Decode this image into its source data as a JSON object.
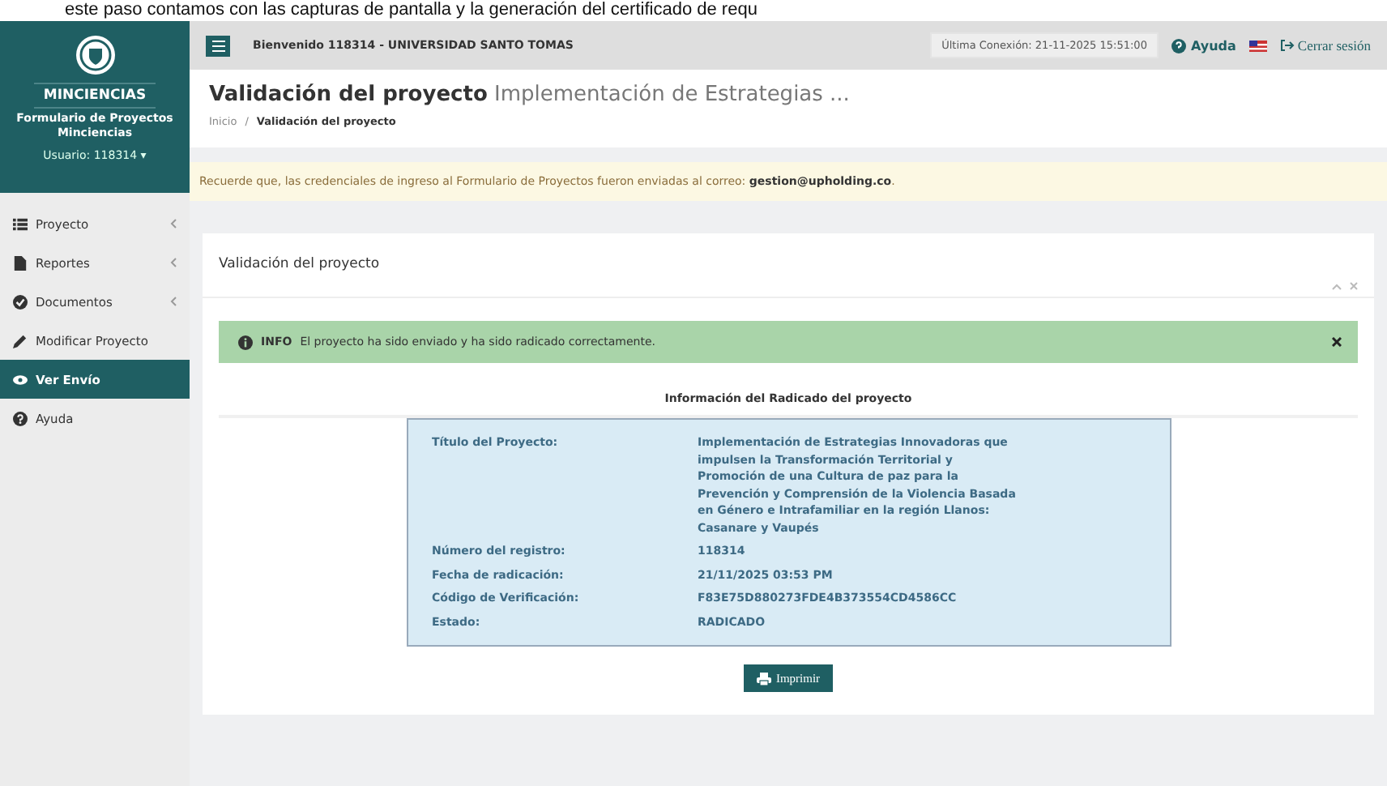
{
  "caption": "este paso contamos con las capturas de pantalla y la generación del certificado de requ",
  "sidebar": {
    "brand": "MINCIENCIAS",
    "subtitle": "Formulario de Proyectos Minciencias",
    "user": "Usuario: 118314 ▾",
    "items": [
      {
        "label": "Proyecto",
        "submenu": true,
        "selected": false
      },
      {
        "label": "Reportes",
        "submenu": true,
        "selected": false
      },
      {
        "label": "Documentos",
        "submenu": true,
        "selected": false
      },
      {
        "label": "Modificar Proyecto",
        "submenu": false,
        "selected": false
      },
      {
        "label": "Ver Envío",
        "submenu": false,
        "selected": true
      },
      {
        "label": "Ayuda",
        "submenu": false,
        "selected": false
      }
    ]
  },
  "topbar": {
    "welcome": "Bienvenido 118314 - UNIVERSIDAD SANTO TOMAS",
    "last_login": "Última Conexión: 21-11-2025 15:51:00",
    "help": "Ayuda",
    "logout": "Cerrar sesión"
  },
  "header": {
    "title": "Validación del proyecto",
    "subtitle": "Implementación de Estrategias ...",
    "breadcrumb": [
      "Inicio",
      "Validación del proyecto"
    ],
    "breadcrumb_separator": "/"
  },
  "notice": "Recuerde que, las credenciales de ingreso al Formulario de Proyectos fueron enviadas al correo: **gestion@upholding.co**.",
  "panel": {
    "title": "Validación del proyecto",
    "alert": {
      "label": "INFO",
      "text": "El proyecto ha sido enviado y ha sido radicado correctamente."
    },
    "section_title": "Información del Radicado del proyecto",
    "rows": [
      {
        "label": "Título del Proyecto:",
        "value": "Implementación de Estrategias Innovadoras que impulsen la Transformación Territorial y Promoción de una Cultura de paz para la Prevención y Comprensión de la Violencia Basada en Género e Intrafamiliar en la región Llanos: Casanare y Vaupés"
      },
      {
        "label": "Número del registro:",
        "value": "118314"
      },
      {
        "label": "Fecha de radicación:",
        "value": "21/11/2025 03:53 PM"
      },
      {
        "label": "Código de Verificación:",
        "value": "F83E75D880273FDE4B373554CD4586CC"
      },
      {
        "label": "Estado:",
        "value": "RADICADO"
      }
    ],
    "print_button": "Imprimir"
  }
}
